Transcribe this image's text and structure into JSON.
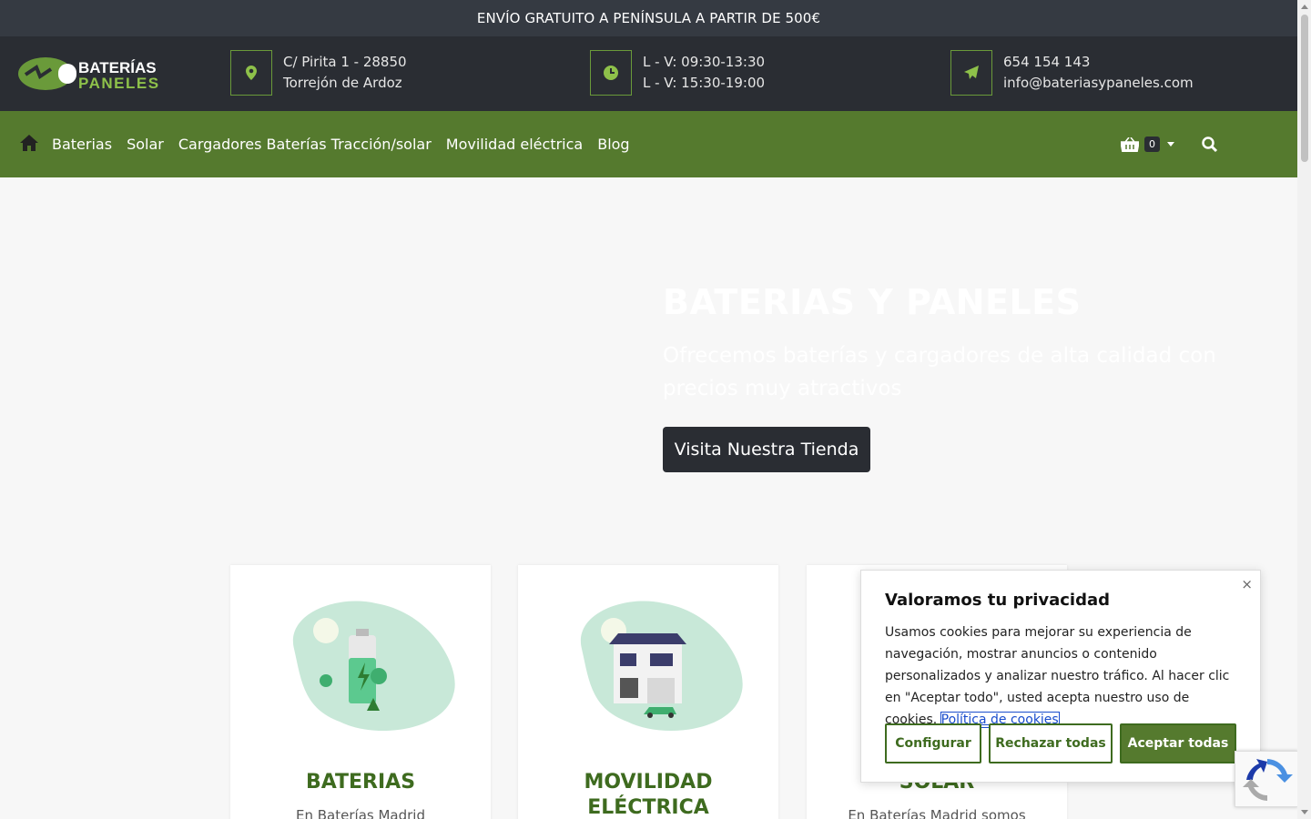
{
  "topbar": {
    "text": "ENVÍO GRATUITO A PENÍNSULA A PARTIR DE 500€"
  },
  "logo": {
    "line1": "BATERÍAS",
    "line2": "PANELES"
  },
  "header": {
    "address": {
      "line1": "C/ Pirita 1 - 28850",
      "line2": "Torrejón de Ardoz"
    },
    "hours": {
      "line1": "L - V: 09:30-13:30",
      "line2": "L - V: 15:30-19:00"
    },
    "contact": {
      "line1": "654 154 143",
      "line2": "info@bateriasypaneles.com"
    }
  },
  "nav": {
    "items": [
      "Baterias",
      "Solar",
      "Cargadores Baterías Tracción/solar",
      "Movilidad eléctrica",
      "Blog"
    ],
    "cart_count": "0"
  },
  "hero": {
    "title": "BATERIAS Y PANELES",
    "subtitle": "Ofrecemos baterías y cargadores de alta calidad con precios muy atractivos",
    "cta": "Visita Nuestra Tienda"
  },
  "cards": [
    {
      "title": "BATERIAS",
      "text": "En Baterías Madrid"
    },
    {
      "title_line1": "MOVILIDAD",
      "title_line2": "ELÉCTRICA"
    },
    {
      "title": "SOLAR",
      "text": "En Baterías Madrid somos"
    }
  ],
  "cookie": {
    "title": "Valoramos tu privacidad",
    "body": "Usamos cookies para mejorar su experiencia de navegación, mostrar anuncios o contenido personalizados y analizar nuestro tráfico. Al hacer clic en \"Aceptar todo\", usted acepta nuestro uso de cookies. ",
    "policy_link": "Política de cookies",
    "configure": "Configurar",
    "reject": "Rechazar todas",
    "accept": "Aceptar todas",
    "close": "×"
  },
  "colors": {
    "brand_green": "#557a2e",
    "dark": "#2a2d33",
    "title_green": "#3e6b1f"
  }
}
